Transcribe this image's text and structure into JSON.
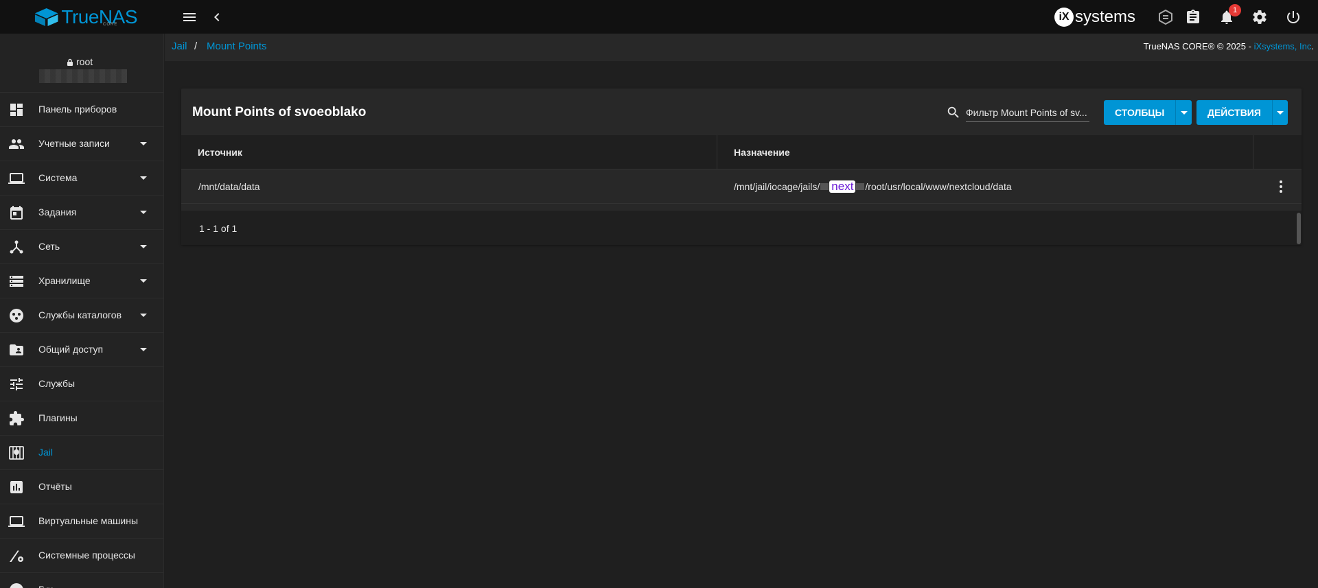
{
  "topbar": {
    "logo_text": "TrueNAS",
    "logo_sub": "CORE",
    "vendor_ix": "iX",
    "vendor_text": "systems",
    "notification_count": "1"
  },
  "sidebar": {
    "user": "root",
    "items": [
      {
        "label": "Панель приборов",
        "icon": "dashboard-icon",
        "expandable": false
      },
      {
        "label": "Учетные записи",
        "icon": "people-icon",
        "expandable": true
      },
      {
        "label": "Система",
        "icon": "laptop-icon",
        "expandable": true
      },
      {
        "label": "Задания",
        "icon": "calendar-icon",
        "expandable": true
      },
      {
        "label": "Сеть",
        "icon": "network-icon",
        "expandable": true
      },
      {
        "label": "Хранилище",
        "icon": "storage-icon",
        "expandable": true
      },
      {
        "label": "Службы каталогов",
        "icon": "directory-icon",
        "expandable": true
      },
      {
        "label": "Общий доступ",
        "icon": "share-folder-icon",
        "expandable": true
      },
      {
        "label": "Службы",
        "icon": "tune-icon",
        "expandable": false
      },
      {
        "label": "Плагины",
        "icon": "puzzle-icon",
        "expandable": false
      },
      {
        "label": "Jail",
        "icon": "jail-icon",
        "expandable": false,
        "active": true
      },
      {
        "label": "Отчёты",
        "icon": "chart-icon",
        "expandable": false
      },
      {
        "label": "Виртуальные машины",
        "icon": "computer-icon",
        "expandable": false
      },
      {
        "label": "Системные процессы",
        "icon": "processes-icon",
        "expandable": false
      },
      {
        "label": "Гуи",
        "icon": "help-icon",
        "expandable": false
      }
    ]
  },
  "breadcrumb": {
    "parent": "Jail",
    "separator": "/",
    "current": "Mount Points"
  },
  "copyright": {
    "text": "TrueNAS CORE® © 2025 - ",
    "link": "iXsystems, Inc",
    "suffix": "."
  },
  "card": {
    "title": "Mount Points of svoeoblako",
    "search_placeholder": "Фильтр Mount Points of sv...",
    "columns_button": "СТОЛБЦЫ",
    "actions_button": "ДЕЙСТВИЯ",
    "headers": [
      "Источник",
      "Назначение"
    ],
    "rows": [
      {
        "source": "/mnt/data/data",
        "dest_prefix": "/mnt/jail/iocage/jails/",
        "dest_highlight": "next",
        "dest_suffix": "/root/usr/local/www/nextcloud/data"
      }
    ],
    "pagination": "1 - 1 of 1"
  },
  "colors": {
    "accent": "#0095d5",
    "background": "#1f1f1f",
    "topbar": "#111111",
    "card": "#282828"
  }
}
